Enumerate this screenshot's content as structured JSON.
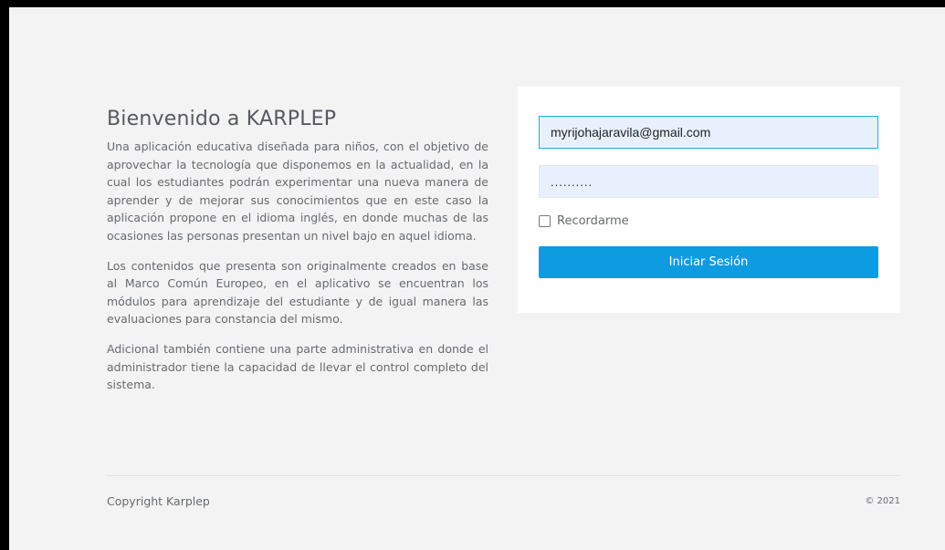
{
  "intro": {
    "title": "Bienvenido a KARPLEP",
    "paragraphs": [
      "Una aplicación educativa diseñada para niños, con el objetivo de aprovechar la tecnología que disponemos en la actualidad, en la cual los estudiantes podrán experimentar una nueva manera de aprender y de mejorar sus conocimientos que en este caso la aplicación propone en el idioma inglés, en donde muchas de las ocasiones las personas presentan un nivel bajo en aquel idioma.",
      "Los contenidos que presenta son originalmente creados en base al Marco Común Europeo, en el aplicativo se encuentran los módulos para aprendizaje del estudiante y de igual manera las evaluaciones para constancia del mismo.",
      "Adicional también contiene una parte administrativa en donde el administrador tiene la capacidad de llevar el control completo del sistema."
    ]
  },
  "login": {
    "email_value": "myrijohajaravila@gmail.com",
    "password_value": "..........",
    "remember_label": "Recordarme",
    "submit_label": "Iniciar Sesión"
  },
  "footer": {
    "copyright": "Copyright Karplep",
    "year": "© 2021"
  },
  "colors": {
    "button": "#0e9ce0",
    "input_fill": "#e8f0fe",
    "focus_border": "#1ab0e0"
  }
}
